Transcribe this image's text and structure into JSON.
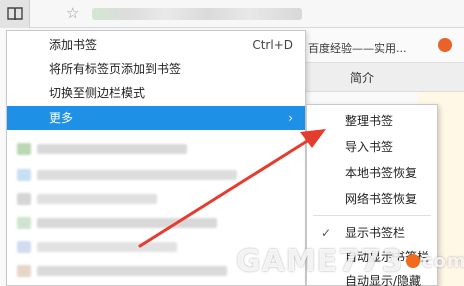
{
  "browser": {
    "bookmark_icon": "bookmark-book-icon",
    "star_icon": "☆"
  },
  "page": {
    "tab_text": "百度经验——实用...",
    "section_label": "简介"
  },
  "menu": {
    "items": [
      {
        "label": "添加书签",
        "shortcut": "Ctrl+D"
      },
      {
        "label": "将所有标签页添加到书签"
      },
      {
        "label": "切换至侧边栏模式"
      },
      {
        "label": "更多",
        "submenu_arrow": "›"
      }
    ]
  },
  "submenu": {
    "items": [
      {
        "label": "整理书签"
      },
      {
        "label": "导入书签"
      },
      {
        "label": "本地书签恢复"
      },
      {
        "label": "网络书签恢复"
      },
      {
        "label": "显示书签栏",
        "check": "✓"
      },
      {
        "label": "自动显示书签栏"
      },
      {
        "label": "自动显示/隐藏"
      }
    ]
  },
  "annotation": {
    "color": "#e63c2e"
  },
  "watermark": {
    "text": "GAME773",
    "tail": "com"
  }
}
